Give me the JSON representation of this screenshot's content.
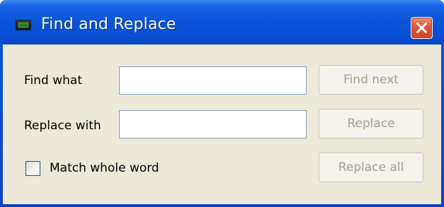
{
  "window": {
    "title": "Find and Replace",
    "icon": "terminal-app-icon",
    "close_icon": "close-icon"
  },
  "form": {
    "find_label": "Find what",
    "find_value": "",
    "replace_label": "Replace with",
    "replace_value": "",
    "match_whole_word_label": "Match whole word",
    "match_whole_word_checked": false
  },
  "buttons": {
    "find_next": "Find next",
    "replace": "Replace",
    "replace_all": "Replace all",
    "disabled": true
  },
  "colors": {
    "titlebar": "#0a55d9",
    "client_bg": "#ece9d8",
    "close_button": "#e2593a",
    "disabled_text": "#a1a192"
  }
}
